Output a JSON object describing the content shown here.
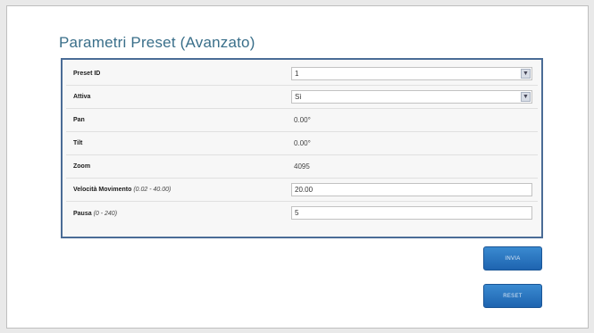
{
  "page": {
    "title": "Parametri Preset (Avanzato)"
  },
  "form": {
    "rows": [
      {
        "label": "Preset ID",
        "hint": "",
        "type": "select",
        "value": "1"
      },
      {
        "label": "Attiva",
        "hint": "",
        "type": "select",
        "value": "Sì"
      },
      {
        "label": "Pan",
        "hint": "",
        "type": "text",
        "value": "0.00°"
      },
      {
        "label": "Tilt",
        "hint": "",
        "type": "text",
        "value": "0.00°"
      },
      {
        "label": "Zoom",
        "hint": "",
        "type": "text",
        "value": "4095"
      },
      {
        "label": "Velocità Movimento",
        "hint": "(0.02 - 40.00)",
        "type": "input",
        "value": "20.00"
      },
      {
        "label": "Pausa",
        "hint": "(0 - 240)",
        "type": "input",
        "value": "5"
      }
    ]
  },
  "buttons": {
    "invia": "INVIA",
    "reset": "RESET"
  },
  "icons": {
    "select_arrow": "chevron-down-icon"
  },
  "colors": {
    "title": "#3a6f8a",
    "panel_border": "#4a6c96",
    "button": "#2a78c2"
  }
}
